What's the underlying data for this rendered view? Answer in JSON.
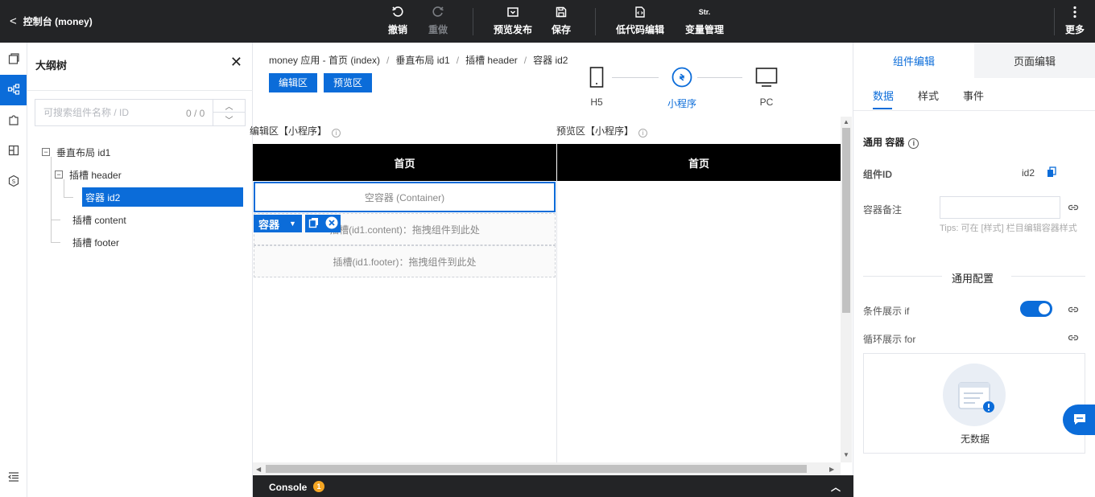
{
  "header": {
    "back_label": "控制台 (money)",
    "undo": "撤销",
    "redo": "重做",
    "preview_publish": "预览发布",
    "save": "保存",
    "lowcode_edit": "低代码编辑",
    "var_icon_text": "Str.",
    "var_manage": "变量管理",
    "more": "更多"
  },
  "outline": {
    "title": "大纲树",
    "search_placeholder": "可搜索组件名称 / ID",
    "search_count": "0 / 0",
    "nodes": [
      {
        "label": "垂直布局 id1"
      },
      {
        "label": "插槽 header"
      },
      {
        "label": "容器 id2"
      },
      {
        "label": "插槽 content"
      },
      {
        "label": "插槽 footer"
      }
    ]
  },
  "canvas": {
    "breadcrumb": [
      "money 应用 - 首页 (index)",
      "垂直布局 id1",
      "插槽 header",
      "容器 id2"
    ],
    "edit_btn": "编辑区",
    "preview_btn": "预览区",
    "devices": [
      {
        "label": "H5",
        "icon": "mobile-icon"
      },
      {
        "label": "小程序",
        "icon": "miniprogram-icon",
        "active": true
      },
      {
        "label": "PC",
        "icon": "monitor-icon"
      }
    ],
    "edit_zone_label": "编辑区【小程序】",
    "preview_zone_label": "预览区【小程序】",
    "page_title": "首页",
    "empty_container": "空容器 (Container)",
    "slot_content": "插槽(id1.content)：拖拽组件到此处",
    "slot_footer": "插槽(id1.footer)：拖拽组件到此处",
    "selected_tag": "容器"
  },
  "console": {
    "label": "Console",
    "badge": "1"
  },
  "rpanel": {
    "tab_component": "组件编辑",
    "tab_page": "页面编辑",
    "sub_tabs": [
      "数据",
      "样式",
      "事件"
    ],
    "section_title": "通用 容器",
    "component_id_label": "组件ID",
    "component_id_value": "id2",
    "note_label": "容器备注",
    "tips": "Tips: 可在 [样式] 栏目编辑容器样式",
    "config_title": "通用配置",
    "cond_label": "条件展示 if",
    "loop_label": "循环展示 for",
    "no_data": "无数据"
  },
  "colors": {
    "accent": "#0b6cd9",
    "topbar": "#232426",
    "badge": "#f5a623"
  }
}
